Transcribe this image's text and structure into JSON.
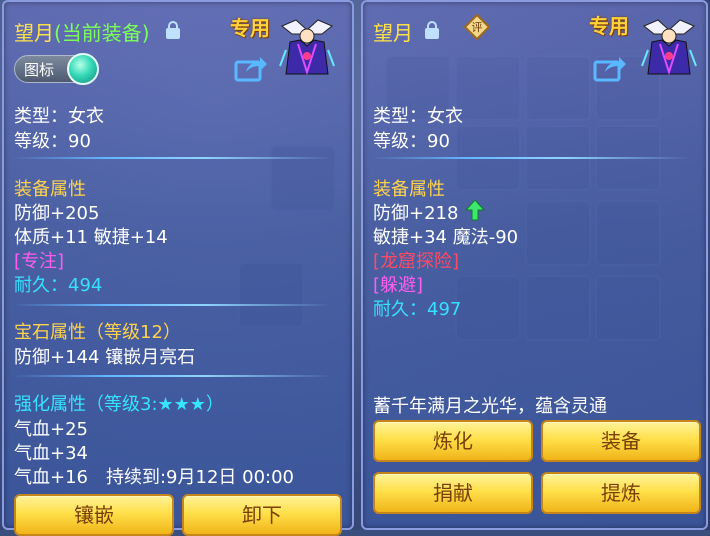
{
  "left": {
    "name": "望月",
    "name_sub": "(当前装备)",
    "exclusive": "专用",
    "icon_toggle_label": "图标",
    "type": "类型：女衣",
    "level": "等级：90",
    "equip_attr_header": "装备属性",
    "attr_lines": [
      "防御+205",
      "体质+11 敏捷+14"
    ],
    "special_skill": "[专注]",
    "durability_label": "耐久：",
    "durability_value": "494",
    "gem_header": "宝石属性（等级12）",
    "gem_line": "防御+144 镶嵌月亮石",
    "enhance_header": "强化属性（等级3:★★★）",
    "enhance_lines": [
      "气血+25",
      "气血+34",
      "气血+16　持续到:9月12日 00:00"
    ],
    "buttons": {
      "inlay": "镶嵌",
      "unequip": "卸下"
    }
  },
  "right": {
    "name": "望月",
    "appraise_label": "评",
    "exclusive": "专用",
    "type": "类型：女衣",
    "level": "等级：90",
    "equip_attr_header": "装备属性",
    "attr_lines": [
      "防御+218",
      "敏捷+34 魔法-90"
    ],
    "special_effect": "[龙窟探险]",
    "special_skill": "[躲避]",
    "durability_label": "耐久：",
    "durability_value": "497",
    "description": "蓄千年满月之光华，蕴含灵通",
    "buttons": {
      "refine": "炼化",
      "equip": "装备",
      "donate": "捐献",
      "extract": "提炼"
    }
  },
  "colors": {
    "name": "#ffe24a",
    "current_equipped": "#7bff58",
    "special": "#ff5cf0",
    "special_effect": "#ff4a64",
    "durability": "#38e0ff",
    "header": "#ffd24c",
    "button_text": "#7a3f06"
  },
  "icons": [
    "lock-icon",
    "share-icon",
    "appraise-badge-icon",
    "upgrade-arrow-icon",
    "item-portrait-icon",
    "toggle-knob-icon"
  ]
}
